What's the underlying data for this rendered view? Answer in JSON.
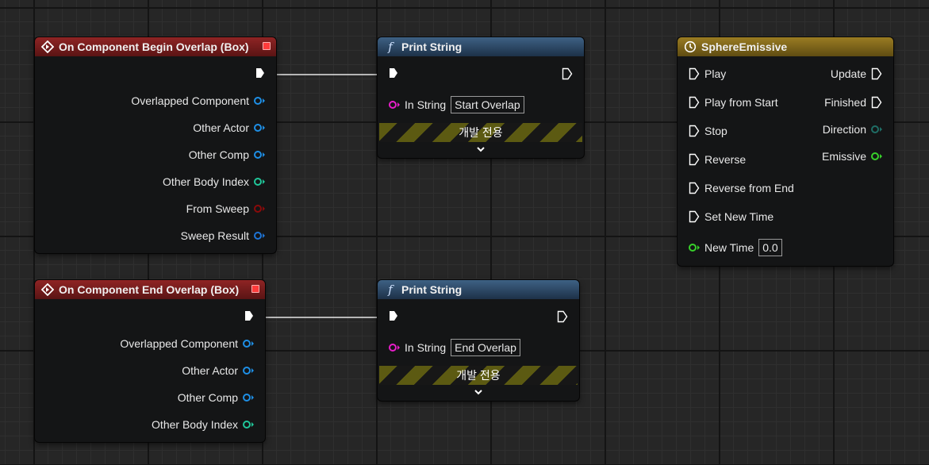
{
  "colors": {
    "event_header": "#7a1e1e",
    "function_header": "#2e4a68",
    "timeline_header": "#8a6e1a",
    "object_pin": "#1e8fe6",
    "struct_pin": "#1e74d6",
    "int_pin": "#20c79a",
    "bool_pin": "#8a0a0a",
    "string_pin": "#e81ec9",
    "float_pin": "#38d12b",
    "vector_pin": "#1fb3a0",
    "stripe_yellow": "#5c5a12"
  },
  "begin_overlap": {
    "title": "On Component Begin Overlap (Box)",
    "outputs": [
      "Overlapped Component",
      "Other Actor",
      "Other Comp",
      "Other Body Index",
      "From Sweep",
      "Sweep Result"
    ]
  },
  "end_overlap": {
    "title": "On Component End Overlap (Box)",
    "outputs": [
      "Overlapped Component",
      "Other Actor",
      "Other Comp",
      "Other Body Index"
    ]
  },
  "print_string_1": {
    "title": "Print String",
    "in_string_label": "In String",
    "in_string_value": "Start Overlap",
    "dev_only_label": "개발 전용",
    "expand_icon": "chevron-down-icon"
  },
  "print_string_2": {
    "title": "Print String",
    "in_string_label": "In String",
    "in_string_value": "End Overlap",
    "dev_only_label": "개발 전용",
    "expand_icon": "chevron-down-icon"
  },
  "timeline": {
    "title": "SphereEmissive",
    "icon": "clock-icon",
    "inputs": [
      "Play",
      "Play from Start",
      "Stop",
      "Reverse",
      "Reverse from End",
      "Set New Time"
    ],
    "new_time_label": "New Time",
    "new_time_value": "0.0",
    "outputs": [
      "Update",
      "Finished",
      "Direction",
      "Emissive"
    ]
  }
}
